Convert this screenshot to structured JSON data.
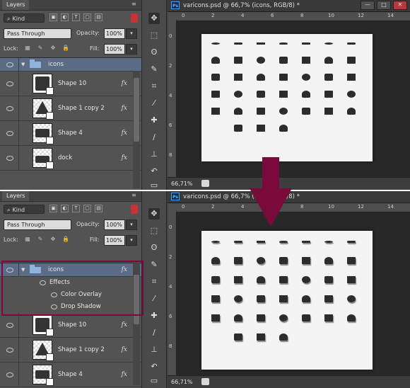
{
  "panel": {
    "tab_label": "Layers",
    "menu_glyph": "≡",
    "kind_label": "Kind",
    "kind_icon": "search-icon",
    "filter_icons": [
      "image-filter-icon",
      "adjustment-filter-icon",
      "type-filter-icon",
      "shape-filter-icon",
      "smart-object-filter-icon"
    ],
    "filter_glyphs": [
      "▣",
      "◐",
      "T",
      "▢",
      "▤"
    ],
    "blend_mode": "Pass Through",
    "opacity_label": "Opacity:",
    "opacity_value": "100%",
    "lock_label": "Lock:",
    "lock_glyphs": [
      "▦",
      "✎",
      "✥",
      "🔒"
    ],
    "fill_label": "Fill:",
    "fill_value": "100%",
    "fx_label": "fx",
    "arrow_glyph": "▾"
  },
  "layers_top": [
    {
      "name": "icons",
      "kind": "group",
      "selected": true
    },
    {
      "name": "Shape 10",
      "kind": "shape",
      "fx": true
    },
    {
      "name": "Shape 1 copy 2",
      "kind": "shape",
      "fx": true
    },
    {
      "name": "Shape 4",
      "kind": "shape",
      "fx": true
    },
    {
      "name": "dock",
      "kind": "shape",
      "fx": true
    }
  ],
  "layers_bottom": [
    {
      "name": "icons",
      "kind": "group",
      "selected": true,
      "fx": true
    },
    {
      "name": "Shape 10",
      "kind": "shape",
      "fx": true
    },
    {
      "name": "Shape 1 copy 2",
      "kind": "shape",
      "fx": true
    },
    {
      "name": "Shape 4",
      "kind": "shape",
      "fx": true
    }
  ],
  "effects": {
    "header": "Effects",
    "items": [
      "Color Overlay",
      "Drop Shadow"
    ]
  },
  "document": {
    "ps_badge": "Ps",
    "title_top": "varicons.psd @ 66,7% (icons, RGB/8) *",
    "title_bottom": "varicons.psd @ 66,7% (icons, RGB/8) *",
    "zoom": "66,71%",
    "ruler_h": [
      "0",
      "2",
      "4",
      "6",
      "8",
      "10",
      "12",
      "14"
    ],
    "ruler_v": [
      "0",
      "2",
      "4",
      "6",
      "8"
    ],
    "win_min": "—",
    "win_max": "□",
    "win_close": "✕"
  },
  "colors": {
    "accent_arrow": "#7a0a3c",
    "selected_layer": "#5b6c86",
    "panel_bg": "#535353"
  }
}
